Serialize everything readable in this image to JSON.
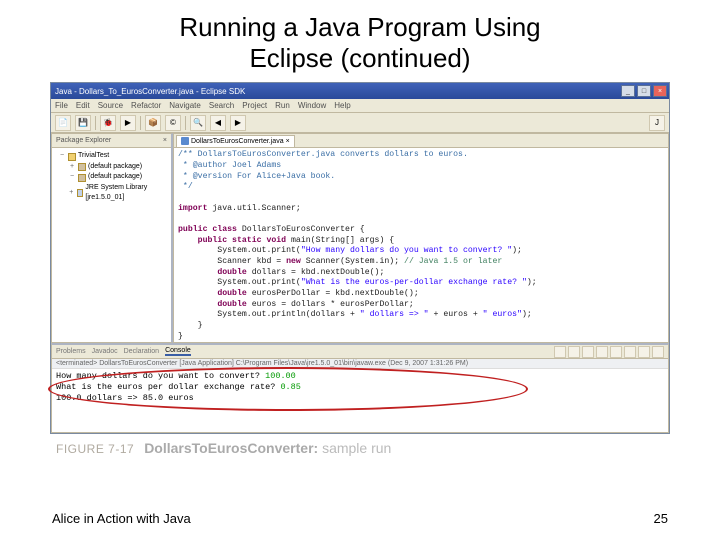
{
  "slide": {
    "title_line1": "Running a Java Program Using",
    "title_line2": "Eclipse (continued)"
  },
  "window": {
    "title": "Java - Dollars_To_EurosConverter.java - Eclipse SDK"
  },
  "menu": {
    "file": "File",
    "edit": "Edit",
    "source": "Source",
    "refactor": "Refactor",
    "navigate": "Navigate",
    "search": "Search",
    "project": "Project",
    "run": "Run",
    "window": "Window",
    "help": "Help"
  },
  "package_explorer": {
    "title": "Package Explorer",
    "items": [
      {
        "tw": "−",
        "icon": "proj",
        "label": "TrivialTest"
      },
      {
        "tw": "+",
        "icon": "pkg",
        "label": "(default package)",
        "indent": 1
      },
      {
        "tw": "−",
        "icon": "pkg",
        "label": "(default package)",
        "indent": 1
      },
      {
        "tw": "+",
        "icon": "lib",
        "label": "JRE System Library [jre1.5.0_01]",
        "indent": 1
      }
    ]
  },
  "editor": {
    "tab": "DollarsToEurosConverter.java",
    "code_lines": [
      {
        "segments": [
          {
            "cls": "cmt",
            "t": "/** DollarsToEurosConverter.java converts dollars to euros."
          }
        ]
      },
      {
        "segments": [
          {
            "cls": "cmt",
            "t": " * @author Joel Adams"
          }
        ]
      },
      {
        "segments": [
          {
            "cls": "cmt",
            "t": " * @version For Alice+Java book."
          }
        ]
      },
      {
        "segments": [
          {
            "cls": "cmt",
            "t": " */"
          }
        ]
      },
      {
        "segments": [
          {
            "cls": "",
            "t": ""
          }
        ]
      },
      {
        "segments": [
          {
            "cls": "kw",
            "t": "import"
          },
          {
            "cls": "",
            "t": " java.util.Scanner;"
          }
        ]
      },
      {
        "segments": [
          {
            "cls": "",
            "t": ""
          }
        ]
      },
      {
        "segments": [
          {
            "cls": "kw",
            "t": "public class"
          },
          {
            "cls": "",
            "t": " DollarsToEurosConverter {"
          }
        ]
      },
      {
        "segments": [
          {
            "cls": "",
            "t": "    "
          },
          {
            "cls": "kw",
            "t": "public static void"
          },
          {
            "cls": "",
            "t": " main(String[] args) {"
          }
        ]
      },
      {
        "segments": [
          {
            "cls": "",
            "t": "        System.out.print("
          },
          {
            "cls": "str",
            "t": "\"How many dollars do you want to convert? \""
          },
          {
            "cls": "",
            "t": ");"
          }
        ]
      },
      {
        "segments": [
          {
            "cls": "",
            "t": "        Scanner kbd = "
          },
          {
            "cls": "kw",
            "t": "new"
          },
          {
            "cls": "",
            "t": " Scanner(System.in); "
          },
          {
            "cls": "ln-cmt",
            "t": "// Java 1.5 or later"
          }
        ]
      },
      {
        "segments": [
          {
            "cls": "",
            "t": "        "
          },
          {
            "cls": "kw",
            "t": "double"
          },
          {
            "cls": "",
            "t": " dollars = kbd.nextDouble();"
          }
        ]
      },
      {
        "segments": [
          {
            "cls": "",
            "t": "        System.out.print("
          },
          {
            "cls": "str",
            "t": "\"What is the euros-per-dollar exchange rate? \""
          },
          {
            "cls": "",
            "t": ");"
          }
        ]
      },
      {
        "segments": [
          {
            "cls": "",
            "t": "        "
          },
          {
            "cls": "kw",
            "t": "double"
          },
          {
            "cls": "",
            "t": " eurosPerDollar = kbd.nextDouble();"
          }
        ]
      },
      {
        "segments": [
          {
            "cls": "",
            "t": "        "
          },
          {
            "cls": "kw",
            "t": "double"
          },
          {
            "cls": "",
            "t": " euros = dollars * eurosPerDollar;"
          }
        ]
      },
      {
        "segments": [
          {
            "cls": "",
            "t": "        System.out.println(dollars + "
          },
          {
            "cls": "str",
            "t": "\" dollars => \""
          },
          {
            "cls": "",
            "t": " + euros + "
          },
          {
            "cls": "str",
            "t": "\" euros\""
          },
          {
            "cls": "",
            "t": ");"
          }
        ]
      },
      {
        "segments": [
          {
            "cls": "",
            "t": "    }"
          }
        ]
      },
      {
        "segments": [
          {
            "cls": "",
            "t": "}"
          }
        ]
      }
    ]
  },
  "console": {
    "tab_problems": "Problems",
    "tab_javadoc": "Javadoc",
    "tab_declaration": "Declaration",
    "tab_console": "Console",
    "info": "<terminated> DollarsToEurosConverter [Java Application] C:\\Program Files\\Java\\jre1.5.0_01\\bin\\javaw.exe (Dec 9, 2007 1:31:26 PM)",
    "line1_prompt": "How many dollars do you want to convert? ",
    "line1_input": "100.00",
    "line2_prompt": "What is the euros per dollar exchange rate? ",
    "line2_input": "0.85",
    "line3_output": "100.0 dollars => 85.0 euros"
  },
  "figure": {
    "label": "FIGURE 7-17",
    "bold": "DollarsToEurosConverter:",
    "rest": " sample run"
  },
  "footer": {
    "left": "Alice in Action with Java",
    "right": "25"
  }
}
